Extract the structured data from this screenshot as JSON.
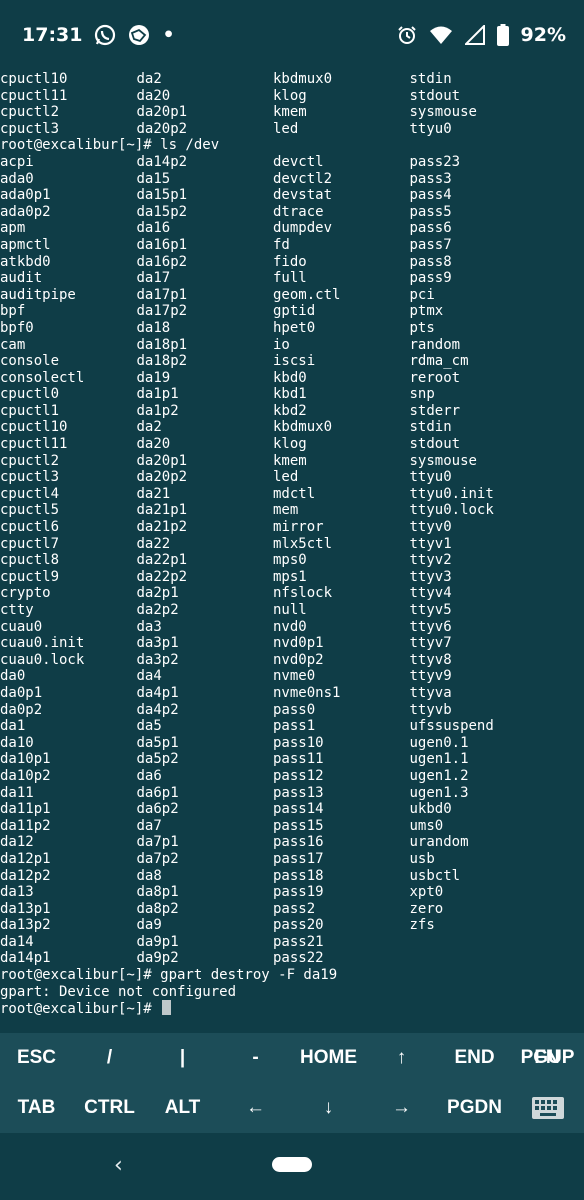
{
  "status_bar": {
    "time": "17:31",
    "dot": "•",
    "battery": "92%",
    "left_icons": [
      "whatsapp-icon",
      "soccer-ball-icon"
    ],
    "right_icons": [
      "alarm-icon",
      "wifi-icon",
      "signal-icon",
      "battery-icon"
    ]
  },
  "terminal": {
    "head_rows": [
      [
        "cpuctl10",
        "da2",
        "kbdmux0",
        "stdin"
      ],
      [
        "cpuctl11",
        "da20",
        "klog",
        "stdout"
      ],
      [
        "cpuctl2",
        "da20p1",
        "kmem",
        "sysmouse"
      ],
      [
        "cpuctl3",
        "da20p2",
        "led",
        "ttyu0"
      ]
    ],
    "command1": "root@excalibur[~]# ls /dev",
    "rows": [
      [
        "acpi",
        "da14p2",
        "devctl",
        "pass23"
      ],
      [
        "ada0",
        "da15",
        "devctl2",
        "pass3"
      ],
      [
        "ada0p1",
        "da15p1",
        "devstat",
        "pass4"
      ],
      [
        "ada0p2",
        "da15p2",
        "dtrace",
        "pass5"
      ],
      [
        "apm",
        "da16",
        "dumpdev",
        "pass6"
      ],
      [
        "apmctl",
        "da16p1",
        "fd",
        "pass7"
      ],
      [
        "atkbd0",
        "da16p2",
        "fido",
        "pass8"
      ],
      [
        "audit",
        "da17",
        "full",
        "pass9"
      ],
      [
        "auditpipe",
        "da17p1",
        "geom.ctl",
        "pci"
      ],
      [
        "bpf",
        "da17p2",
        "gptid",
        "ptmx"
      ],
      [
        "bpf0",
        "da18",
        "hpet0",
        "pts"
      ],
      [
        "cam",
        "da18p1",
        "io",
        "random"
      ],
      [
        "console",
        "da18p2",
        "iscsi",
        "rdma_cm"
      ],
      [
        "consolectl",
        "da19",
        "kbd0",
        "reroot"
      ],
      [
        "cpuctl0",
        "da1p1",
        "kbd1",
        "snp"
      ],
      [
        "cpuctl1",
        "da1p2",
        "kbd2",
        "stderr"
      ],
      [
        "cpuctl10",
        "da2",
        "kbdmux0",
        "stdin"
      ],
      [
        "cpuctl11",
        "da20",
        "klog",
        "stdout"
      ],
      [
        "cpuctl2",
        "da20p1",
        "kmem",
        "sysmouse"
      ],
      [
        "cpuctl3",
        "da20p2",
        "led",
        "ttyu0"
      ],
      [
        "cpuctl4",
        "da21",
        "mdctl",
        "ttyu0.init"
      ],
      [
        "cpuctl5",
        "da21p1",
        "mem",
        "ttyu0.lock"
      ],
      [
        "cpuctl6",
        "da21p2",
        "mirror",
        "ttyv0"
      ],
      [
        "cpuctl7",
        "da22",
        "mlx5ctl",
        "ttyv1"
      ],
      [
        "cpuctl8",
        "da22p1",
        "mps0",
        "ttyv2"
      ],
      [
        "cpuctl9",
        "da22p2",
        "mps1",
        "ttyv3"
      ],
      [
        "crypto",
        "da2p1",
        "nfslock",
        "ttyv4"
      ],
      [
        "ctty",
        "da2p2",
        "null",
        "ttyv5"
      ],
      [
        "cuau0",
        "da3",
        "nvd0",
        "ttyv6"
      ],
      [
        "cuau0.init",
        "da3p1",
        "nvd0p1",
        "ttyv7"
      ],
      [
        "cuau0.lock",
        "da3p2",
        "nvd0p2",
        "ttyv8"
      ],
      [
        "da0",
        "da4",
        "nvme0",
        "ttyv9"
      ],
      [
        "da0p1",
        "da4p1",
        "nvme0ns1",
        "ttyva"
      ],
      [
        "da0p2",
        "da4p2",
        "pass0",
        "ttyvb"
      ],
      [
        "da1",
        "da5",
        "pass1",
        "ufssuspend"
      ],
      [
        "da10",
        "da5p1",
        "pass10",
        "ugen0.1"
      ],
      [
        "da10p1",
        "da5p2",
        "pass11",
        "ugen1.1"
      ],
      [
        "da10p2",
        "da6",
        "pass12",
        "ugen1.2"
      ],
      [
        "da11",
        "da6p1",
        "pass13",
        "ugen1.3"
      ],
      [
        "da11p1",
        "da6p2",
        "pass14",
        "ukbd0"
      ],
      [
        "da11p2",
        "da7",
        "pass15",
        "ums0"
      ],
      [
        "da12",
        "da7p1",
        "pass16",
        "urandom"
      ],
      [
        "da12p1",
        "da7p2",
        "pass17",
        "usb"
      ],
      [
        "da12p2",
        "da8",
        "pass18",
        "usbctl"
      ],
      [
        "da13",
        "da8p1",
        "pass19",
        "xpt0"
      ],
      [
        "da13p1",
        "da8p2",
        "pass2",
        "zero"
      ],
      [
        "da13p2",
        "da9",
        "pass20",
        "zfs"
      ],
      [
        "da14",
        "da9p1",
        "pass21",
        ""
      ],
      [
        "da14p1",
        "da9p2",
        "pass22",
        ""
      ]
    ],
    "command2": "root@excalibur[~]# gpart destroy -F da19",
    "error": "gpart: Device not configured",
    "prompt": "root@excalibur[~]# "
  },
  "extra_keys": {
    "row1": [
      "ESC",
      "/",
      "|",
      "-",
      "HOME",
      "↑",
      "END",
      "PGUP",
      "FN"
    ],
    "row2": [
      "TAB",
      "CTRL",
      "ALT",
      "←",
      "↓",
      "→",
      "PGDN",
      "keyboard-icon"
    ]
  },
  "nav_bar": {
    "back": "‹"
  },
  "colors": {
    "background": "#0f3d47",
    "keys_background": "#1c4d58",
    "text": "#ffffff"
  }
}
